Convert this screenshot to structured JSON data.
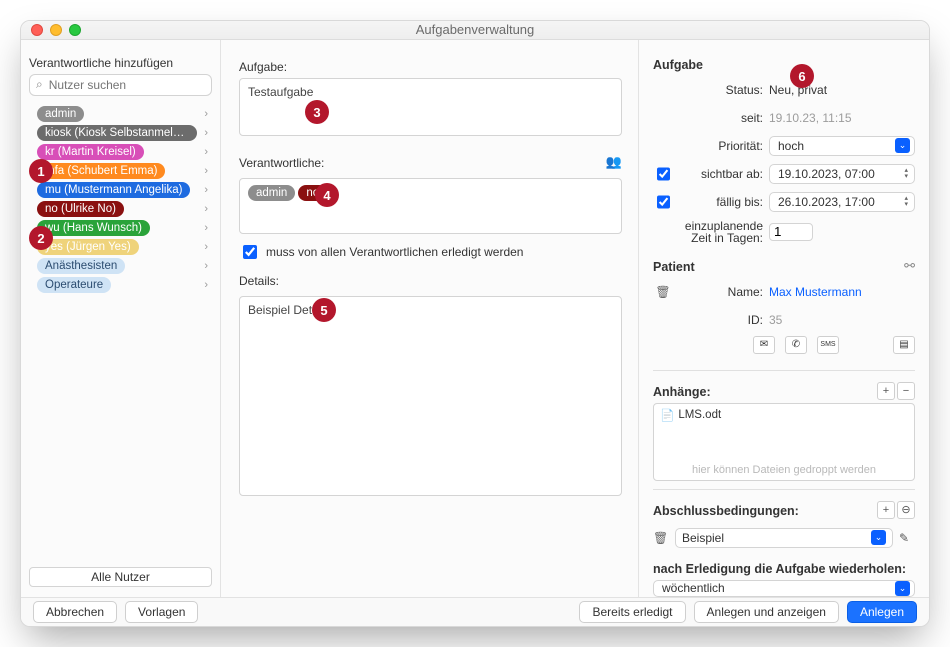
{
  "window": {
    "title": "Aufgabenverwaltung"
  },
  "left": {
    "header": "Verantwortliche hinzufügen",
    "search_placeholder": "Nutzer suchen",
    "users": [
      {
        "label": "admin",
        "color": "#8d8d8d"
      },
      {
        "label": "kiosk (Kiosk Selbstanmeldu…",
        "color": "#6c6c6c"
      },
      {
        "label": "kr (Martin Kreisel)",
        "color": "#d84fb8"
      },
      {
        "label": "mfa (Schubert Emma)",
        "color": "#ff8a1f"
      },
      {
        "label": "mu (Mustermann Angelika)",
        "color": "#1e6be0"
      },
      {
        "label": "no (Ulrike No)",
        "color": "#8a1010"
      },
      {
        "label": "wu (Hans Wunsch)",
        "color": "#2aa33a"
      },
      {
        "label": "yes (Jürgen Yes)",
        "color": "#efd37b"
      }
    ],
    "groups": [
      {
        "label": "Anästhesisten"
      },
      {
        "label": "Operateure"
      }
    ],
    "all_users": "Alle Nutzer"
  },
  "middle": {
    "aufgabe_label": "Aufgabe:",
    "aufgabe_value": "Testaufgabe",
    "verantwortliche_label": "Verantwortliche:",
    "assigned": [
      {
        "label": "admin",
        "color": "#8d8d8d"
      },
      {
        "label": "no",
        "color": "#8a1010"
      }
    ],
    "must_all_label": "muss von allen Verantwortlichen erledigt werden",
    "details_label": "Details:",
    "details_value": "Beispiel Details"
  },
  "right": {
    "header": "Aufgabe",
    "status_label": "Status:",
    "status_value": "Neu, privat",
    "seit_label": "seit:",
    "seit_value": "19.10.23, 11:15",
    "prioritaet_label": "Priorität:",
    "prioritaet_value": "hoch",
    "sichtbar_label": "sichtbar ab:",
    "sichtbar_value": "19.10.2023, 07:00",
    "faellig_label": "fällig bis:",
    "faellig_value": "26.10.2023, 17:00",
    "einzuplanende_label": "einzuplanende Zeit in Tagen:",
    "einzuplanende_value": "1",
    "patient_header": "Patient",
    "name_label": "Name:",
    "name_value": "Max Mustermann",
    "id_label": "ID:",
    "id_value": "35",
    "anhaenge_label": "Anhänge:",
    "attachments": [
      {
        "name": "LMS.odt"
      }
    ],
    "drop_hint": "hier können Dateien gedroppt werden",
    "abschluss_label": "Abschlussbedingungen:",
    "conditions": [
      {
        "text": "Beispiel"
      }
    ],
    "repeat_label": "nach Erledigung die Aufgabe wiederholen:",
    "repeat_value": "wöchentlich"
  },
  "footer": {
    "abbrechen": "Abbrechen",
    "vorlagen": "Vorlagen",
    "bereits": "Bereits erledigt",
    "anlegen_anzeigen": "Anlegen und anzeigen",
    "anlegen": "Anlegen"
  },
  "callouts": {
    "c1": "1",
    "c2": "2",
    "c3": "3",
    "c4": "4",
    "c5": "5",
    "c6": "6"
  }
}
